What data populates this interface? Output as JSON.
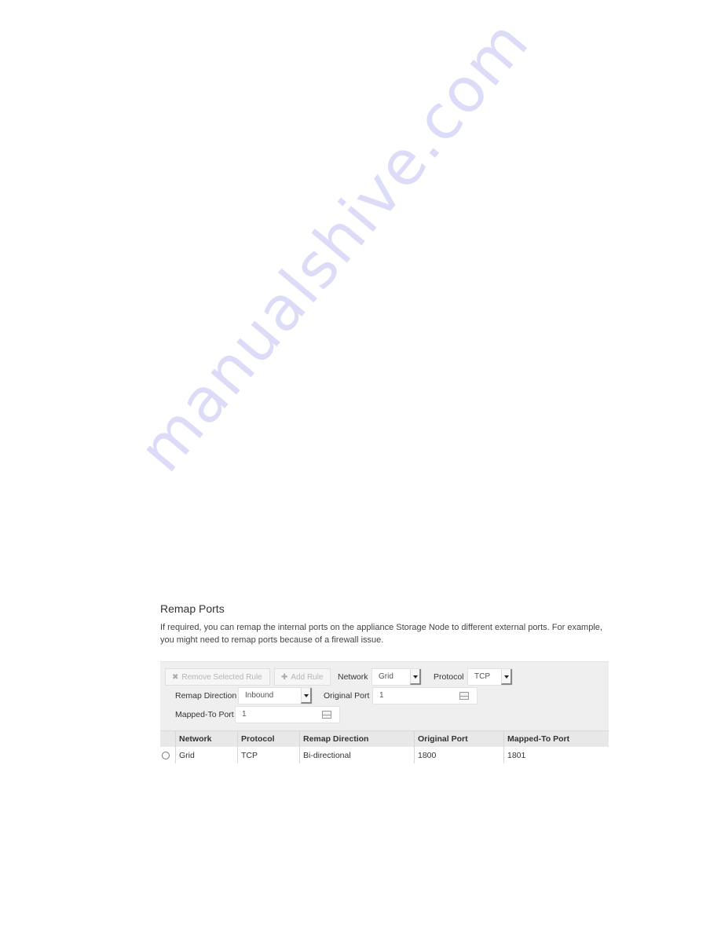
{
  "watermark": "manualshive.com",
  "section": {
    "title": "Remap Ports",
    "description": "If required, you can remap the internal ports on the appliance Storage Node to different external ports. For example, you might need to remap ports because of a firewall issue."
  },
  "toolbar": {
    "remove_label": "Remove Selected Rule",
    "remove_icon": "x-icon",
    "add_label": "Add Rule",
    "add_icon": "plus-icon",
    "network_label": "Network",
    "network_value": "Grid",
    "protocol_label": "Protocol",
    "protocol_value": "TCP",
    "remap_direction_label": "Remap Direction",
    "remap_direction_value": "Inbound",
    "original_port_label": "Original Port",
    "original_port_value": "1",
    "mapped_port_label": "Mapped-To Port",
    "mapped_port_value": "1"
  },
  "table": {
    "columns": [
      "",
      "Network",
      "Protocol",
      "Remap Direction",
      "Original Port",
      "Mapped-To Port"
    ],
    "rows": [
      {
        "network": "Grid",
        "protocol": "TCP",
        "direction": "Bi-directional",
        "original_port": "1800",
        "mapped_port": "1801"
      }
    ]
  }
}
